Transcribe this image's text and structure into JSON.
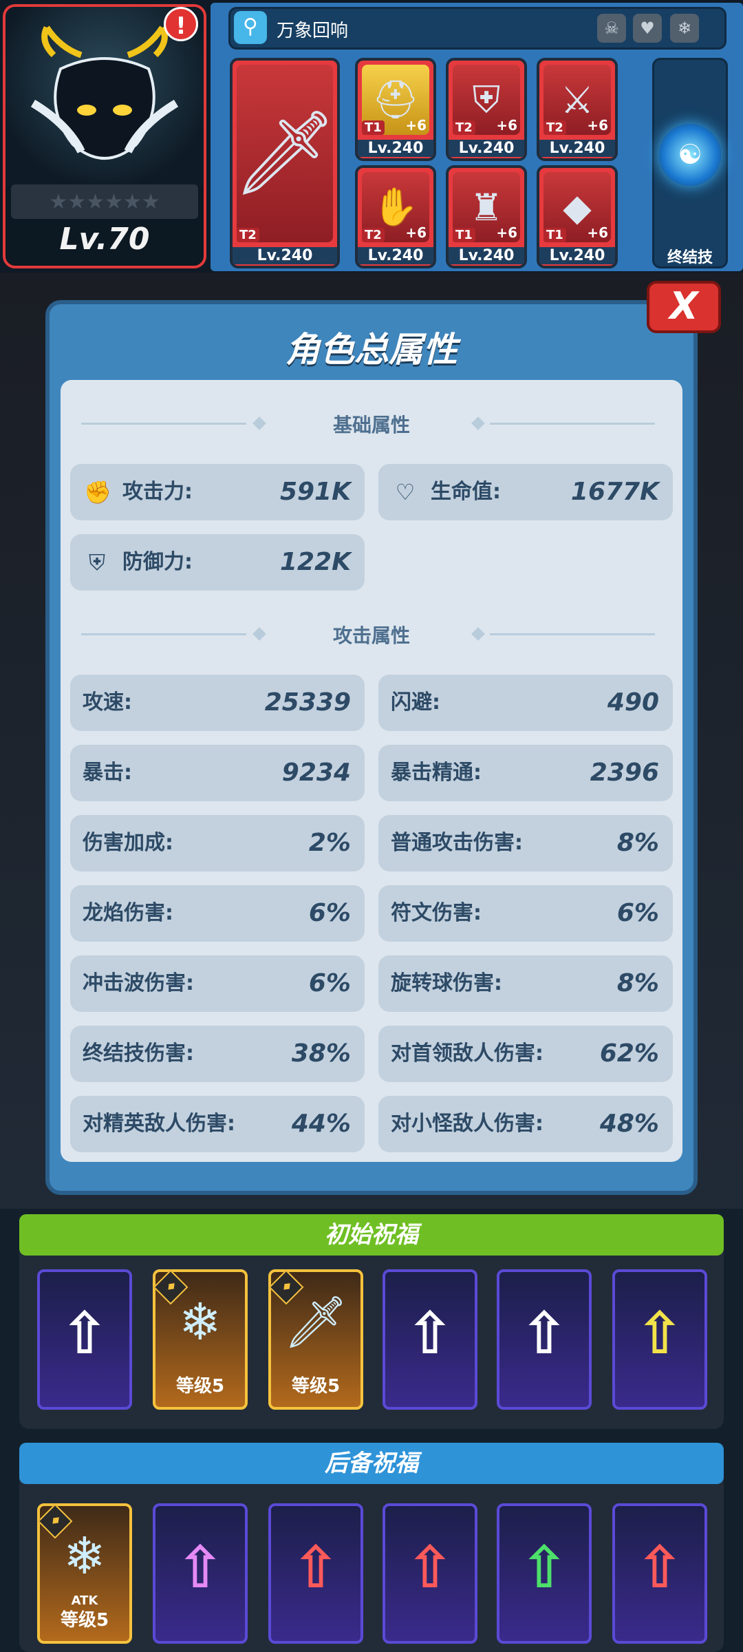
{
  "hero": {
    "level": "Lv.70",
    "alert": "!",
    "stars": "★★★★★★"
  },
  "search": {
    "label": "万象回响"
  },
  "equipment": [
    {
      "tier": "T2",
      "plus": "",
      "level": "Lv.240",
      "icon": "sword"
    },
    {
      "tier": "T1",
      "plus": "+6",
      "level": "Lv.240",
      "icon": "helmet"
    },
    {
      "tier": "T2",
      "plus": "+6",
      "level": "Lv.240",
      "icon": "armor"
    },
    {
      "tier": "T2",
      "plus": "+6",
      "level": "Lv.240",
      "icon": "cape"
    },
    {
      "tier": "T2",
      "plus": "+6",
      "level": "Lv.240",
      "icon": "gauntlet"
    },
    {
      "tier": "T1",
      "plus": "+6",
      "level": "Lv.240",
      "icon": "boots"
    },
    {
      "tier": "T1",
      "plus": "+6",
      "level": "Lv.240",
      "icon": "amulet"
    }
  ],
  "ultimate": {
    "label": "终结技"
  },
  "panel": {
    "title": "角色总属性",
    "close": "X",
    "basic_header": "基础属性",
    "attack_header": "攻击属性",
    "basic": {
      "atk": {
        "label": "攻击力:",
        "value": "591K"
      },
      "hp": {
        "label": "生命值:",
        "value": "1677K"
      },
      "def": {
        "label": "防御力:",
        "value": "122K"
      }
    },
    "attack": [
      {
        "label": "攻速:",
        "value": "25339"
      },
      {
        "label": "闪避:",
        "value": "490"
      },
      {
        "label": "暴击:",
        "value": "9234"
      },
      {
        "label": "暴击精通:",
        "value": "2396"
      },
      {
        "label": "伤害加成:",
        "value": "2%"
      },
      {
        "label": "普通攻击伤害:",
        "value": "8%"
      },
      {
        "label": "龙焰伤害:",
        "value": "6%"
      },
      {
        "label": "符文伤害:",
        "value": "6%"
      },
      {
        "label": "冲击波伤害:",
        "value": "6%"
      },
      {
        "label": "旋转球伤害:",
        "value": "8%"
      },
      {
        "label": "终结技伤害:",
        "value": "38%"
      },
      {
        "label": "对首领敌人伤害:",
        "value": "62%"
      },
      {
        "label": "对精英敌人伤害:",
        "value": "44%"
      },
      {
        "label": "对小怪敌人伤害:",
        "value": "48%"
      }
    ]
  },
  "initial_blessings": {
    "title": "初始祝福",
    "color": "#6fbf24",
    "cards": [
      {
        "type": "arrow",
        "arrow": "⇧",
        "color": "#ffffff"
      },
      {
        "type": "skill",
        "icon": "snow-vortex",
        "glyph": "❄",
        "level": "等级5"
      },
      {
        "type": "skill",
        "icon": "ice-sword",
        "glyph": "🗡",
        "level": "等级5"
      },
      {
        "type": "arrow",
        "arrow": "⇧",
        "color": "#ffffff"
      },
      {
        "type": "arrow",
        "arrow": "⇧",
        "color": "#ffffff"
      },
      {
        "type": "arrow",
        "arrow": "⇧",
        "color": "#f2e24a"
      }
    ]
  },
  "backup_blessings": {
    "title": "后备祝福",
    "color": "#2f93d8",
    "cards": [
      {
        "type": "skill",
        "icon": "snowflakes",
        "glyph": "❄",
        "level": "等级5",
        "atk": "ATK"
      },
      {
        "type": "arrow",
        "arrow": "⇧",
        "color": "#e58af5"
      },
      {
        "type": "arrow",
        "arrow": "⇧",
        "color": "#ff5a5a"
      },
      {
        "type": "arrow",
        "arrow": "⇧",
        "color": "#ff5a5a"
      },
      {
        "type": "arrow",
        "arrow": "⇧",
        "color": "#4de06a"
      },
      {
        "type": "arrow",
        "arrow": "⇧",
        "color": "#ff5a5a"
      }
    ]
  }
}
